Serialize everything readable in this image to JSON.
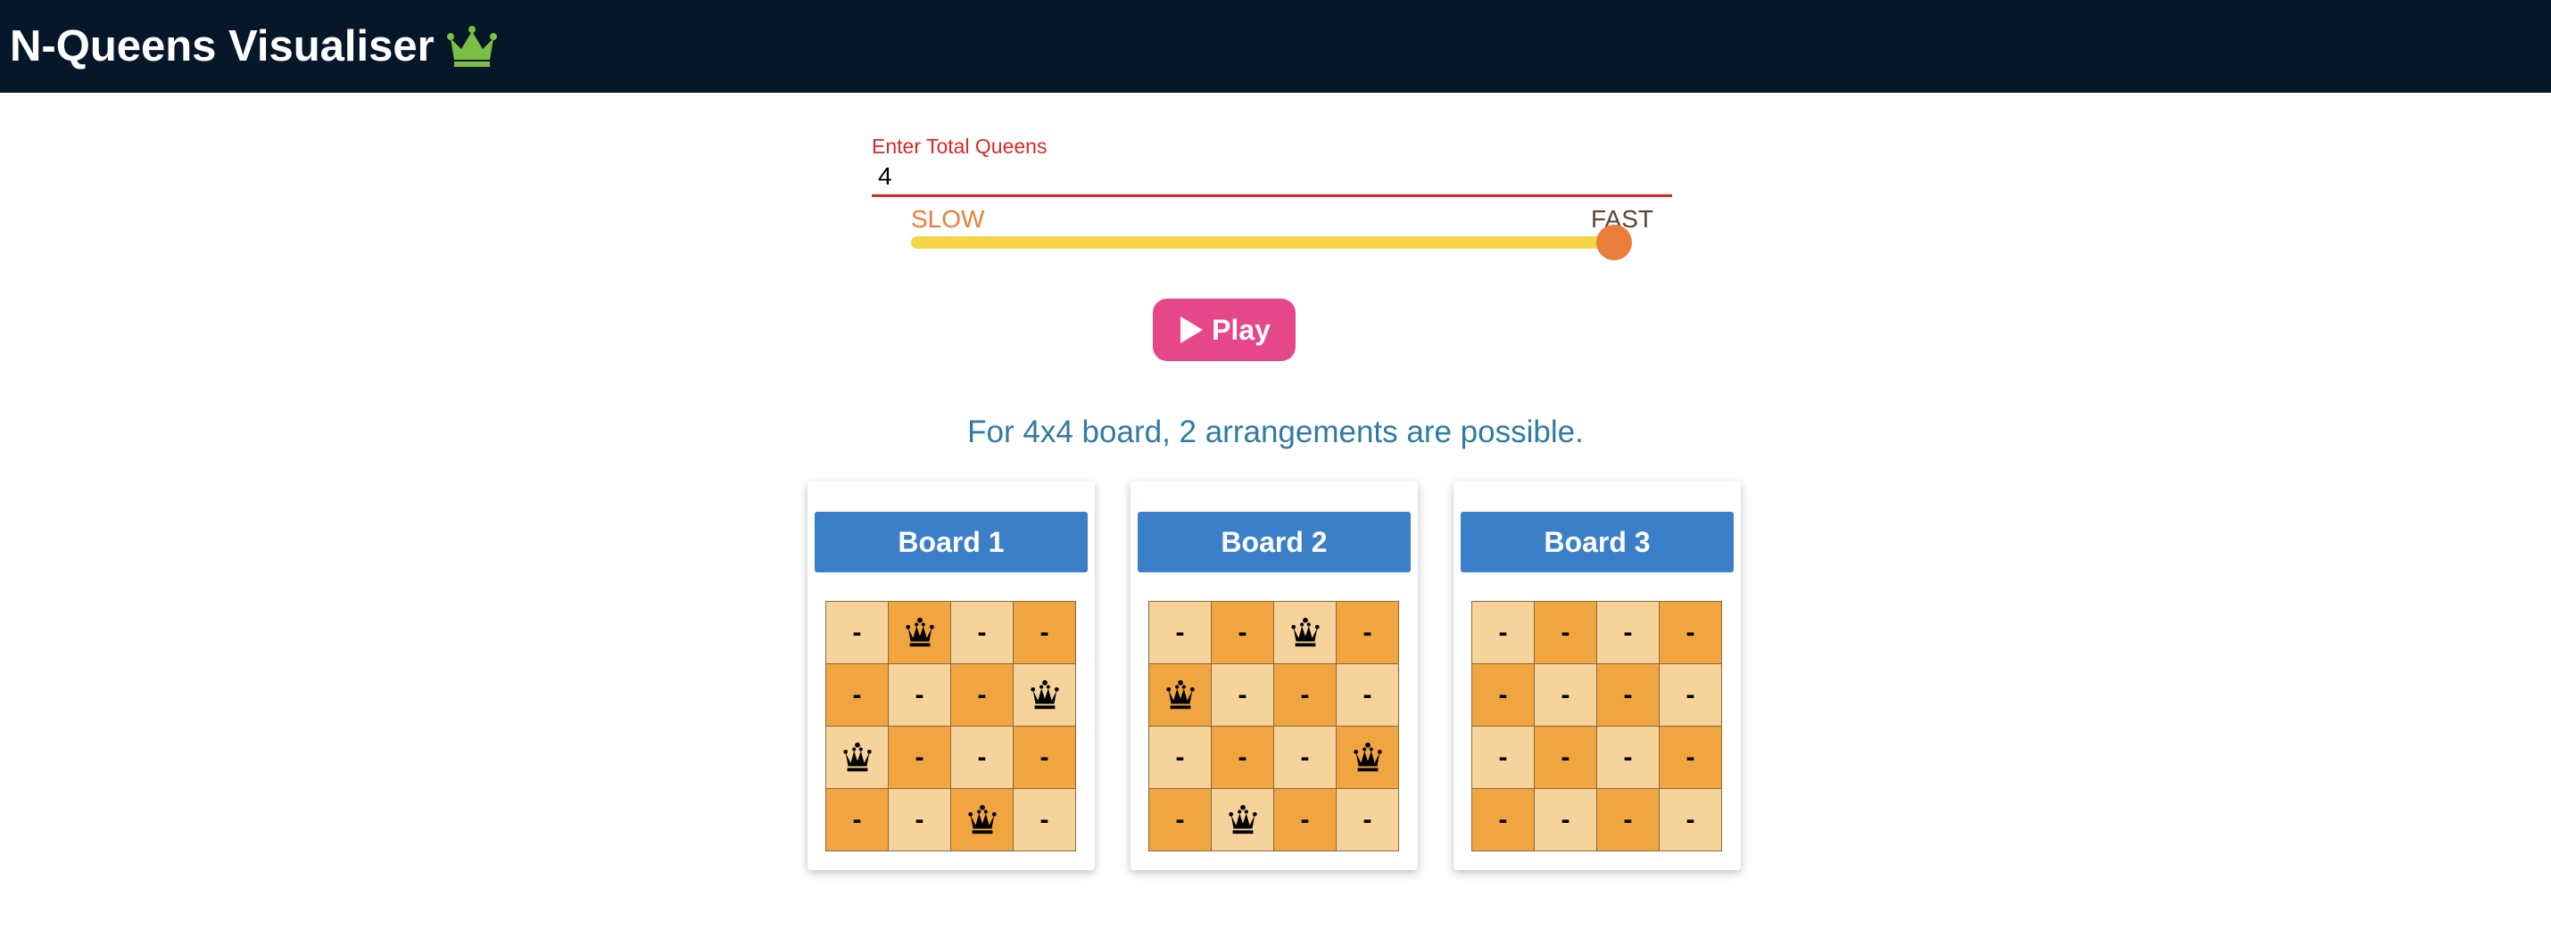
{
  "header": {
    "title": "N-Queens Visualiser",
    "logo_icon": "crown-icon",
    "logo_color": "#7cc043",
    "bg_color": "#07172a"
  },
  "controls": {
    "input_label": "Enter Total Queens",
    "queens_value": "4",
    "slow_label": "SLOW",
    "fast_label": "FAST",
    "speed_level": 1.0,
    "play_label": "Play"
  },
  "result": {
    "text": "For 4x4 board, 2 arrangements are possible."
  },
  "colors": {
    "light_cell": "#f5d39b",
    "dark_cell": "#f0a540",
    "board_header": "#3a7fc8",
    "play_button": "#e6468a"
  },
  "boards": [
    {
      "title": "Board 1",
      "cells": [
        [
          "-",
          "Q",
          "-",
          "-"
        ],
        [
          "-",
          "-",
          "-",
          "Q"
        ],
        [
          "Q",
          "-",
          "-",
          "-"
        ],
        [
          "-",
          "-",
          "Q",
          "-"
        ]
      ]
    },
    {
      "title": "Board 2",
      "cells": [
        [
          "-",
          "-",
          "Q",
          "-"
        ],
        [
          "Q",
          "-",
          "-",
          "-"
        ],
        [
          "-",
          "-",
          "-",
          "Q"
        ],
        [
          "-",
          "Q",
          "-",
          "-"
        ]
      ]
    },
    {
      "title": "Board 3",
      "cells": [
        [
          "-",
          "-",
          "-",
          "-"
        ],
        [
          "-",
          "-",
          "-",
          "-"
        ],
        [
          "-",
          "-",
          "-",
          "-"
        ],
        [
          "-",
          "-",
          "-",
          "-"
        ]
      ]
    }
  ]
}
